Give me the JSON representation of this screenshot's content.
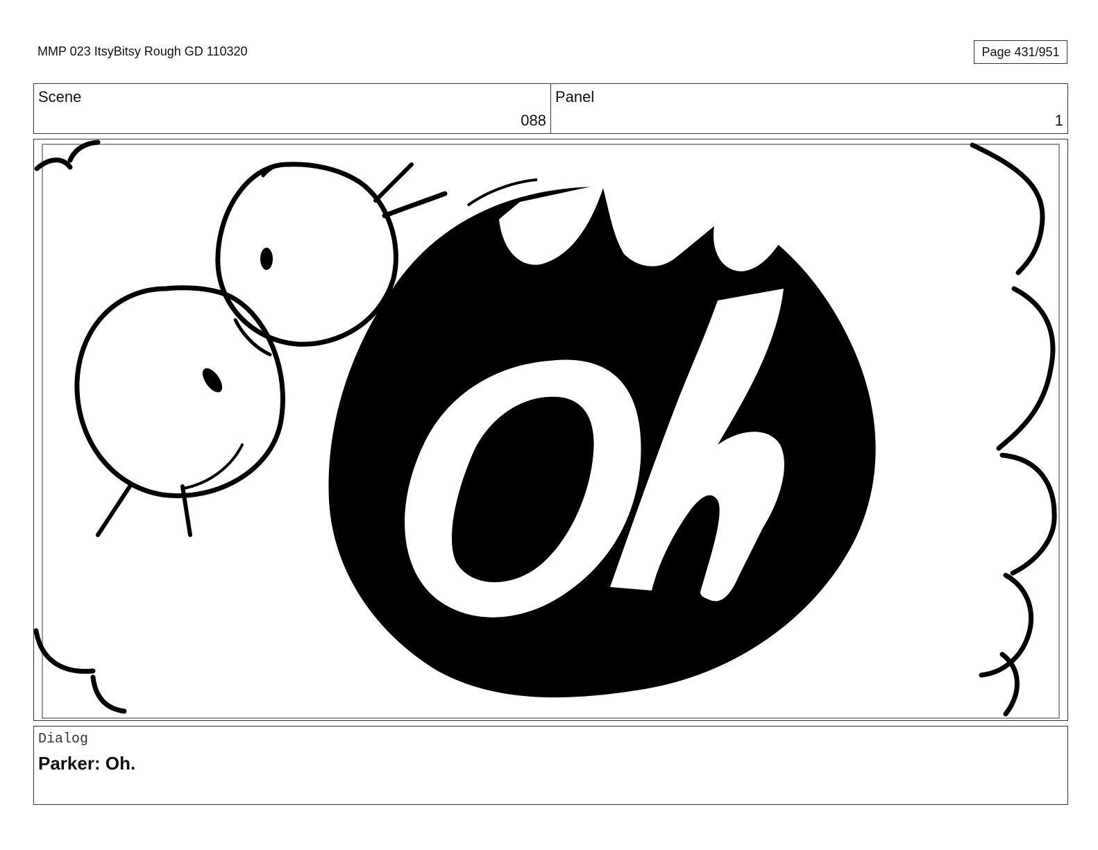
{
  "header": {
    "document_title": "MMP 023 ItsyBitsy Rough GD 110320",
    "page_indicator": "Page 431/951"
  },
  "info": {
    "scene_label": "Scene",
    "scene_value": "088",
    "panel_label": "Panel",
    "panel_value": "1"
  },
  "panel_art": {
    "lettering": "Oh",
    "ink_color": "#000000",
    "paper_color": "#ffffff"
  },
  "dialog": {
    "label": "Dialog",
    "text": "Parker: Oh."
  }
}
